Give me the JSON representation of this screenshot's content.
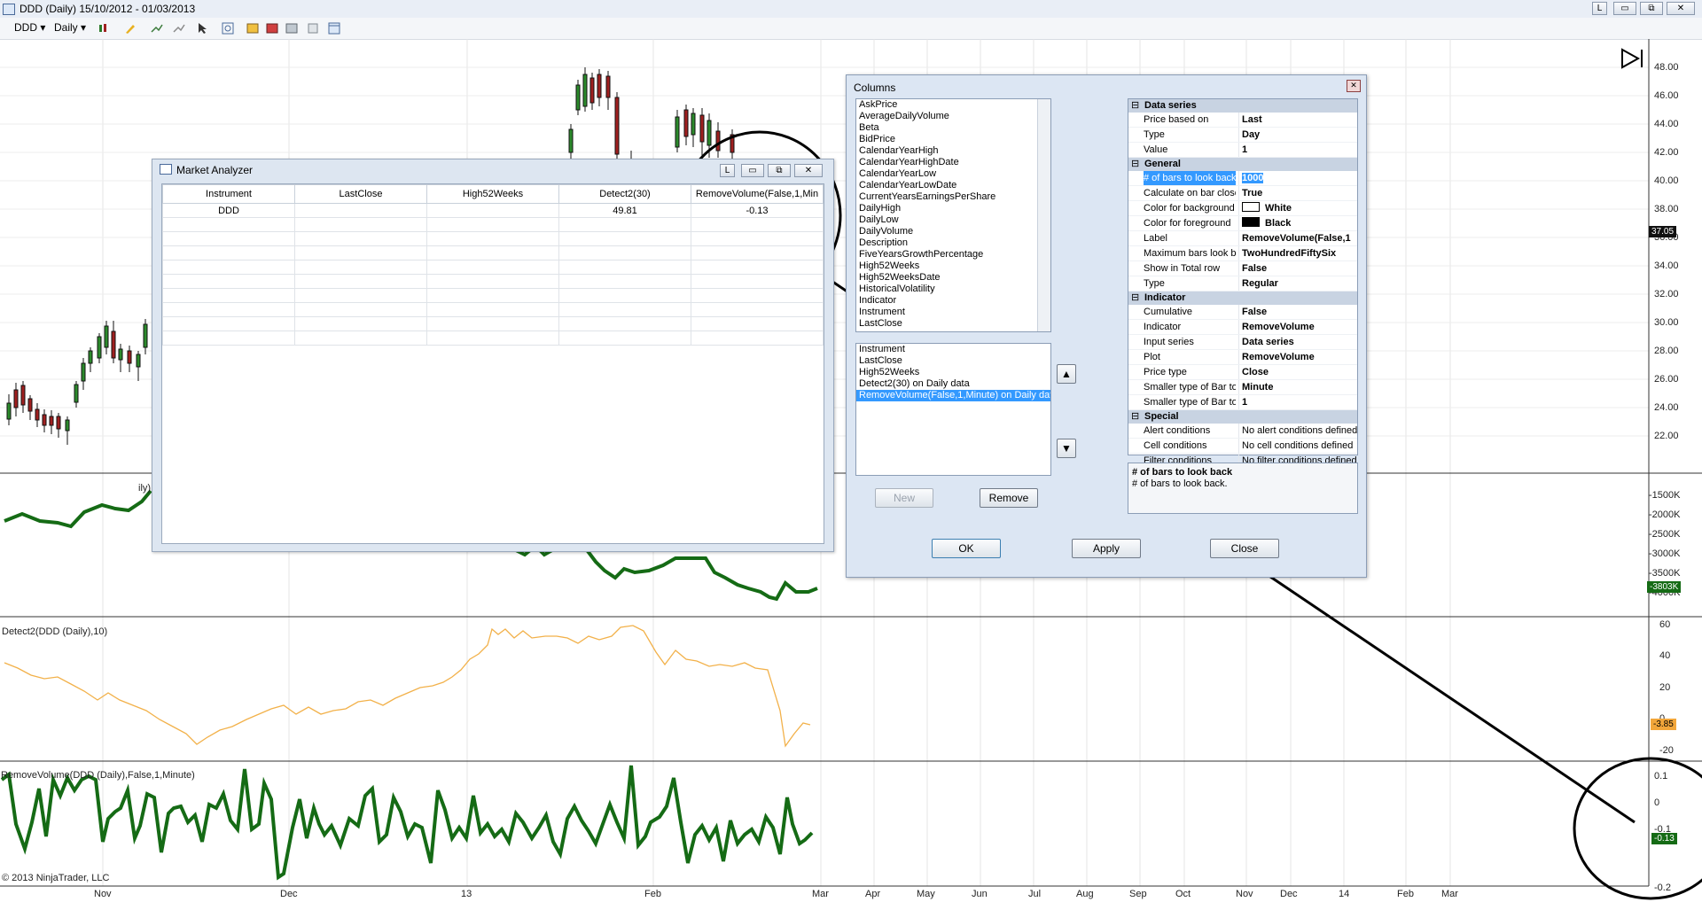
{
  "window": {
    "title": "DDD (Daily)  15/10/2012 - 01/03/2013"
  },
  "toolbar": {
    "instrument": "DDD",
    "interval": "Daily"
  },
  "price_axis": [
    "48.00",
    "46.00",
    "44.00",
    "42.00",
    "40.00",
    "38.00",
    "36.00",
    "34.00",
    "32.00",
    "30.00",
    "28.00",
    "26.00",
    "24.00",
    "22.00"
  ],
  "price_tag": "37.05",
  "volume_axis": [
    "-1500K",
    "-2000K",
    "-2500K",
    "-3000K",
    "-3500K",
    "-4000K"
  ],
  "volume_tag": "-3803K",
  "detect_panel": {
    "label": "Detect2(DDD (Daily),10)",
    "axis": [
      "60",
      "40",
      "20",
      "0",
      "-20"
    ],
    "tag": "-3.85"
  },
  "remove_panel": {
    "label": "RemoveVolume(DDD (Daily),False,1,Minute)",
    "axis": [
      "0.1",
      "0",
      "-0.1",
      "-0.2"
    ],
    "tag": "-0.13"
  },
  "copyright": "© 2013 NinjaTrader, LLC",
  "x_axis": [
    "Nov",
    "Dec",
    "13",
    "Feb",
    "Mar",
    "Apr",
    "May",
    "Jun",
    "Jul",
    "Aug",
    "Sep",
    "Oct",
    "Nov",
    "Dec",
    "14",
    "Feb",
    "Mar"
  ],
  "partial_label": "ily)",
  "market_analyzer": {
    "title": "Market Analyzer",
    "columns": [
      "Instrument",
      "LastClose",
      "High52Weeks",
      "Detect2(30)",
      "RemoveVolume(False,1,Min"
    ],
    "rows": [
      [
        "DDD",
        "",
        "",
        "49.81",
        "-0.13"
      ]
    ]
  },
  "columns_dialog": {
    "title": "Columns",
    "available": [
      "AskPrice",
      "AverageDailyVolume",
      "Beta",
      "BidPrice",
      "CalendarYearHigh",
      "CalendarYearHighDate",
      "CalendarYearLow",
      "CalendarYearLowDate",
      "CurrentYearsEarningsPerShare",
      "DailyHigh",
      "DailyLow",
      "DailyVolume",
      "Description",
      "FiveYearsGrowthPercentage",
      "High52Weeks",
      "High52WeeksDate",
      "HistoricalVolatility",
      "Indicator",
      "Instrument",
      "LastClose"
    ],
    "selected": [
      "Instrument",
      "LastClose",
      "High52Weeks",
      "Detect2(30) on Daily data",
      "RemoveVolume(False,1,Minute) on Daily data"
    ],
    "buttons": {
      "new": "New",
      "remove": "Remove",
      "ok": "OK",
      "apply": "Apply",
      "close": "Close"
    },
    "properties": [
      {
        "category": "Data series",
        "rows": [
          [
            "Price based on",
            "Last"
          ],
          [
            "Type",
            "Day"
          ],
          [
            "Value",
            "1"
          ]
        ]
      },
      {
        "category": "General",
        "rows": [
          [
            "# of bars to look back",
            "1000"
          ],
          [
            "Calculate on bar close",
            "True"
          ],
          [
            "Color for background",
            "White"
          ],
          [
            "Color for foreground",
            "Black"
          ],
          [
            "Label",
            "RemoveVolume(False,1"
          ],
          [
            "Maximum bars look back",
            "TwoHundredFiftySix"
          ],
          [
            "Show in Total row",
            "False"
          ],
          [
            "Type",
            "Regular"
          ]
        ]
      },
      {
        "category": "Indicator",
        "rows": [
          [
            "Cumulative",
            "False"
          ],
          [
            "Indicator",
            "RemoveVolume"
          ],
          [
            "Input series",
            "Data series"
          ],
          [
            "Plot",
            "RemoveVolume"
          ],
          [
            "Price type",
            "Close"
          ],
          [
            "Smaller type of Bar to",
            "Minute"
          ],
          [
            "Smaller type of Bar to",
            "1"
          ]
        ]
      },
      {
        "category": "Special",
        "rows": [
          [
            "Alert conditions",
            "No alert conditions defined"
          ],
          [
            "Cell conditions",
            "No cell conditions defined"
          ],
          [
            "Filter conditions",
            "No filter conditions defined"
          ]
        ]
      }
    ],
    "description": {
      "title": "# of bars to look back",
      "text": "# of bars to look back."
    }
  }
}
